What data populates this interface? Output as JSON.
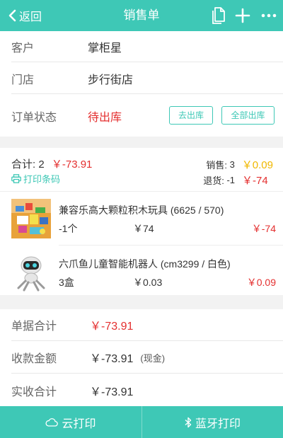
{
  "header": {
    "back_label": "返回",
    "title": "销售单",
    "icons": [
      "document-icon",
      "plus-icon",
      "more-icon"
    ]
  },
  "order": {
    "customer_label": "客户",
    "customer": "掌柜星",
    "store_label": "门店",
    "store": "步行街店",
    "status_label": "订单状态",
    "status": "待出库",
    "btn_out": "去出库",
    "btn_all_out": "全部出库"
  },
  "summary": {
    "total_label": "合计:",
    "total_count": "2",
    "total_amount": "￥-73.91",
    "print_barcode": "打印条码",
    "sales_label": "销售:",
    "sales_count": "3",
    "sales_amount": "￥0.09",
    "return_label": "退货:",
    "return_count": "-1",
    "return_amount": "￥-74"
  },
  "items": [
    {
      "name": "兼容乐高大颗粒积木玩具 (6625 / 570)",
      "qty": "-1个",
      "price": "￥74",
      "amount": "￥-74"
    },
    {
      "name": "六爪鱼儿童智能机器人 (cm3299 / 白色)",
      "qty": "3盒",
      "price": "￥0.03",
      "amount": "￥0.09"
    }
  ],
  "totals": {
    "doc_total_label": "单据合计",
    "doc_total": "￥-73.91",
    "received_label": "收款金额",
    "received": "￥-73.91",
    "received_method": "(现金)",
    "actual_label": "实收合计",
    "actual": "￥-73.91"
  },
  "footer": {
    "cloud_print": "云打印",
    "bt_print": "蓝牙打印"
  },
  "colors": {
    "accent": "#3ec8b6",
    "red": "#e42f2f",
    "yellow": "#f0b800"
  }
}
